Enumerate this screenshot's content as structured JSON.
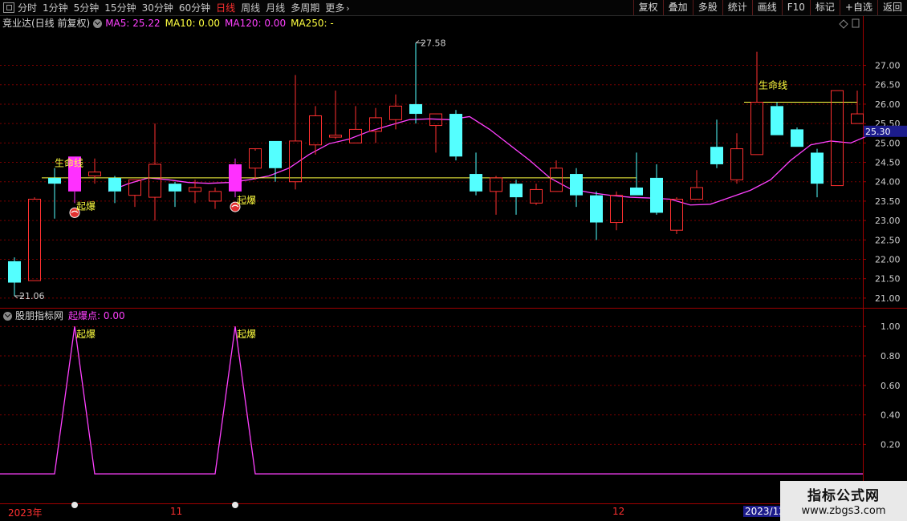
{
  "toolbar": {
    "periods": [
      "分时",
      "1分钟",
      "5分钟",
      "15分钟",
      "30分钟",
      "60分钟",
      "日线",
      "周线",
      "月线",
      "多周期",
      "更多"
    ],
    "active_period": "日线",
    "right_buttons": [
      "复权",
      "叠加",
      "多股",
      "统计",
      "画线",
      "F10",
      "标记",
      "+自选",
      "返回"
    ]
  },
  "main_panel": {
    "title": "竞业达(日线 前复权)",
    "ma_labels": [
      {
        "text": "MA5: 25.22",
        "color": "#ff40ff"
      },
      {
        "text": "MA10: 0.00",
        "color": "#ffff40"
      },
      {
        "text": "MA120: 0.00",
        "color": "#ff40ff"
      },
      {
        "text": "MA250: -",
        "color": "#ffff40"
      }
    ],
    "high_label": "27.58",
    "low_label": "21.06",
    "current_price": "25.30",
    "annotation_life_line": "生命线",
    "annotation_burst": "起爆"
  },
  "sub_panel": {
    "title": "股朋指标网",
    "indicator_label": "起爆点: 0.00",
    "annotation_burst": "起爆"
  },
  "time_axis": {
    "labels": [
      "2023年",
      "11",
      "12",
      "2023/12"
    ]
  },
  "watermark": {
    "line1": "指标公式网",
    "line2": "www.zbgs3.com"
  },
  "colors": {
    "up": "#ff3030",
    "down": "#54ffff",
    "ma5": "#ff40ff",
    "life_line": "#ffff40",
    "grid": "#7a0000",
    "burst": "#ffff40"
  },
  "chart_data": {
    "type": "candlestick",
    "y_axis_ticks": [
      21.0,
      21.5,
      22.0,
      22.5,
      23.0,
      23.5,
      24.0,
      24.5,
      25.0,
      25.5,
      26.0,
      26.5,
      27.0
    ],
    "ylim": [
      20.75,
      27.9
    ],
    "candles": [
      {
        "o": 21.95,
        "h": 22.05,
        "l": 21.06,
        "c": 21.4
      },
      {
        "o": 21.45,
        "h": 23.6,
        "l": 21.45,
        "c": 23.55
      },
      {
        "o": 24.1,
        "h": 24.35,
        "l": 23.05,
        "c": 23.95
      },
      {
        "o": 23.75,
        "h": 24.65,
        "l": 23.45,
        "c": 24.65
      },
      {
        "o": 24.15,
        "h": 24.6,
        "l": 23.95,
        "c": 24.25
      },
      {
        "o": 24.1,
        "h": 24.15,
        "l": 23.45,
        "c": 23.75
      },
      {
        "o": 23.65,
        "h": 24.05,
        "l": 23.35,
        "c": 24.05
      },
      {
        "o": 23.6,
        "h": 25.5,
        "l": 23.0,
        "c": 24.45
      },
      {
        "o": 23.95,
        "h": 24.0,
        "l": 23.35,
        "c": 23.75
      },
      {
        "o": 23.75,
        "h": 24.05,
        "l": 23.45,
        "c": 23.85
      },
      {
        "o": 23.5,
        "h": 23.85,
        "l": 23.3,
        "c": 23.75
      },
      {
        "o": 23.75,
        "h": 24.6,
        "l": 23.6,
        "c": 24.45
      },
      {
        "o": 24.35,
        "h": 24.8,
        "l": 24.05,
        "c": 24.85
      },
      {
        "o": 25.05,
        "h": 25.05,
        "l": 24.0,
        "c": 24.35
      },
      {
        "o": 24.0,
        "h": 26.75,
        "l": 23.8,
        "c": 25.05
      },
      {
        "o": 24.95,
        "h": 25.95,
        "l": 24.7,
        "c": 25.7
      },
      {
        "o": 25.15,
        "h": 26.35,
        "l": 25.1,
        "c": 25.2
      },
      {
        "o": 25.0,
        "h": 25.95,
        "l": 25.0,
        "c": 25.35
      },
      {
        "o": 25.3,
        "h": 25.9,
        "l": 25.0,
        "c": 25.65
      },
      {
        "o": 25.6,
        "h": 26.25,
        "l": 25.35,
        "c": 25.95
      },
      {
        "o": 26.0,
        "h": 27.58,
        "l": 25.5,
        "c": 25.75
      },
      {
        "o": 25.45,
        "h": 25.75,
        "l": 24.75,
        "c": 25.75
      },
      {
        "o": 25.75,
        "h": 25.85,
        "l": 24.55,
        "c": 24.65
      },
      {
        "o": 24.2,
        "h": 24.75,
        "l": 23.65,
        "c": 23.75
      },
      {
        "o": 23.75,
        "h": 24.15,
        "l": 23.15,
        "c": 24.1
      },
      {
        "o": 23.95,
        "h": 24.05,
        "l": 23.15,
        "c": 23.6
      },
      {
        "o": 23.45,
        "h": 23.95,
        "l": 23.4,
        "c": 23.8
      },
      {
        "o": 23.75,
        "h": 24.55,
        "l": 23.75,
        "c": 24.35
      },
      {
        "o": 24.2,
        "h": 24.35,
        "l": 23.35,
        "c": 23.65
      },
      {
        "o": 23.65,
        "h": 23.75,
        "l": 22.5,
        "c": 22.95
      },
      {
        "o": 22.95,
        "h": 23.75,
        "l": 22.75,
        "c": 23.65
      },
      {
        "o": 23.85,
        "h": 24.75,
        "l": 23.65,
        "c": 23.65
      },
      {
        "o": 24.1,
        "h": 24.45,
        "l": 23.15,
        "c": 23.2
      },
      {
        "o": 22.75,
        "h": 23.6,
        "l": 22.65,
        "c": 23.55
      },
      {
        "o": 23.55,
        "h": 24.3,
        "l": 23.55,
        "c": 23.85
      },
      {
        "o": 24.9,
        "h": 25.6,
        "l": 24.35,
        "c": 24.45
      },
      {
        "o": 24.05,
        "h": 25.25,
        "l": 23.95,
        "c": 24.85
      },
      {
        "o": 24.7,
        "h": 27.35,
        "l": 24.7,
        "c": 26.05
      },
      {
        "o": 25.95,
        "h": 26.05,
        "l": 25.2,
        "c": 25.2
      },
      {
        "o": 25.35,
        "h": 25.4,
        "l": 24.9,
        "c": 24.9
      },
      {
        "o": 24.75,
        "h": 24.85,
        "l": 23.6,
        "c": 23.95
      },
      {
        "o": 23.9,
        "h": 26.35,
        "l": 23.9,
        "c": 26.35
      },
      {
        "o": 25.5,
        "h": 26.35,
        "l": 25.5,
        "c": 25.75
      }
    ],
    "burst_candles": [
      3,
      11
    ],
    "life_line_1": {
      "value": 24.1,
      "from": 2,
      "to": 31
    },
    "life_line_2": {
      "value": 26.05,
      "from": 37,
      "to": 42
    },
    "ma5_values": [
      null,
      null,
      null,
      null,
      23.75,
      23.95,
      24.1,
      24.05,
      23.98,
      23.96,
      23.98,
      24.05,
      24.15,
      24.35,
      24.7,
      24.98,
      25.1,
      25.3,
      25.45,
      25.6,
      25.62,
      25.6,
      25.68,
      25.35,
      24.95,
      24.55,
      24.1,
      23.82,
      23.72,
      23.65,
      23.6,
      23.58,
      23.55,
      23.4,
      23.42,
      23.6,
      23.78,
      24.05,
      24.55,
      24.95,
      25.05,
      25.0,
      25.22
    ],
    "indicator": {
      "type": "line",
      "y_ticks": [
        0.2,
        0.4,
        0.6,
        0.8,
        1.0
      ],
      "ylim": [
        -0.2,
        1.05
      ],
      "peaks": [
        3,
        11
      ],
      "values_baseline": 0.0,
      "values_peak": 1.0
    }
  }
}
